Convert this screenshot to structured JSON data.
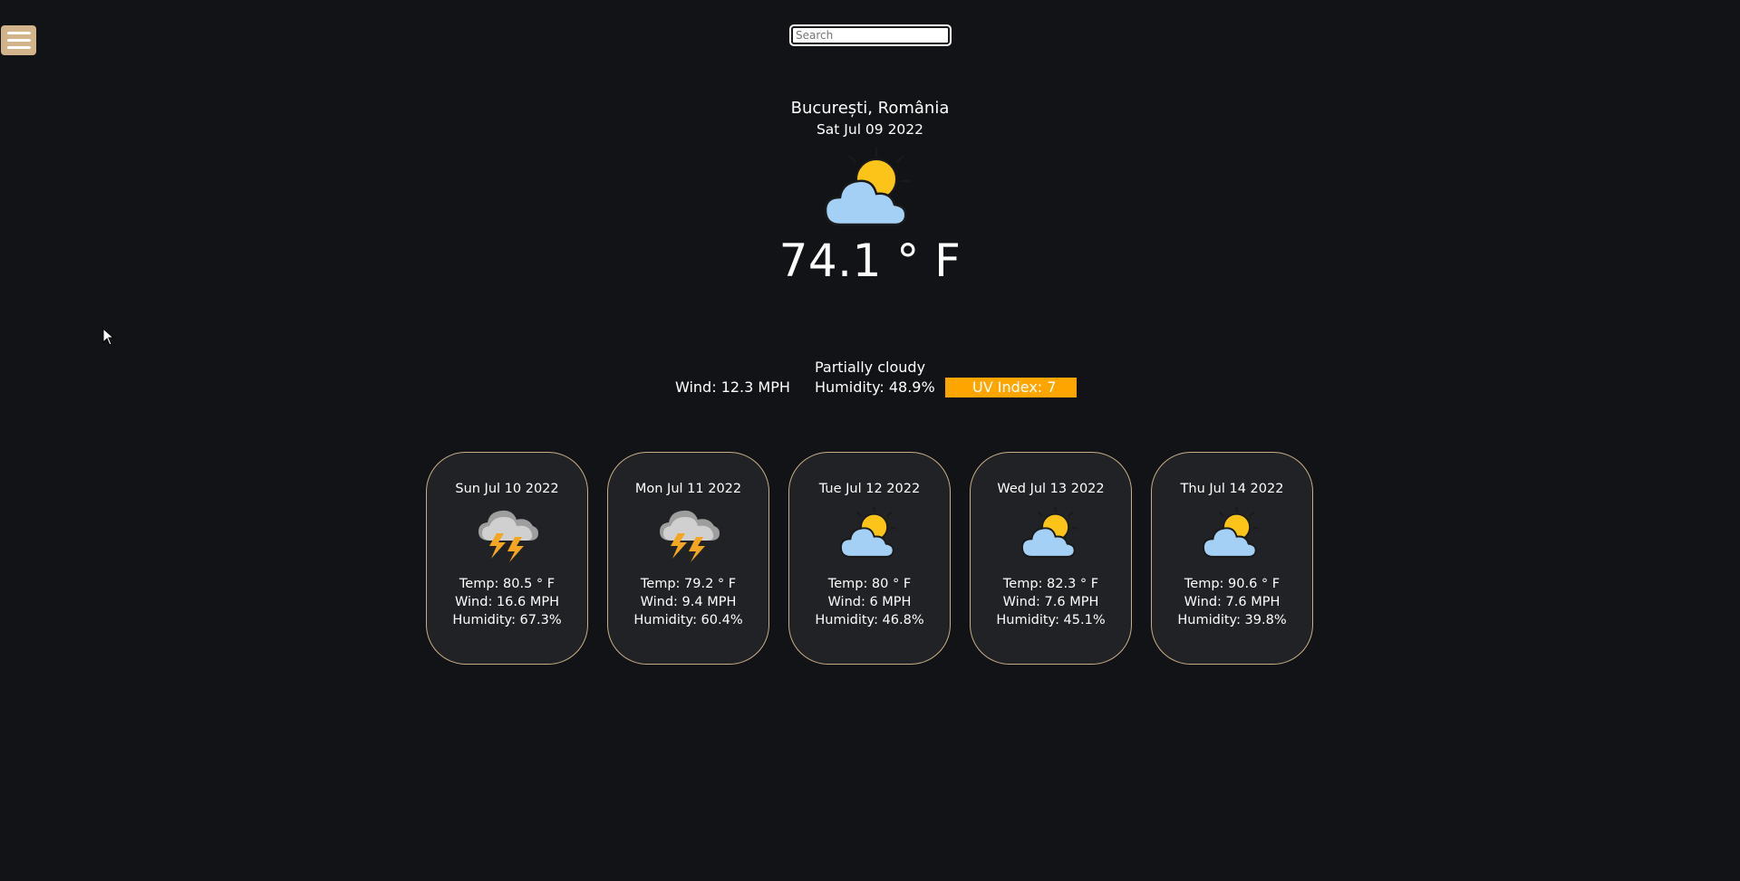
{
  "menu": {
    "icon": "hamburger-menu-icon"
  },
  "search": {
    "placeholder": "Search",
    "value": ""
  },
  "current": {
    "location": "București, România",
    "date": "Sat Jul 09 2022",
    "icon": "partly-cloudy-icon",
    "temperature": "74.1 ° F",
    "conditions": "Partially cloudy",
    "wind": "Wind: 12.3 MPH",
    "humidity": "Humidity: 48.9%",
    "uv": "UV Index: 7"
  },
  "colors": {
    "background": "#121317",
    "card_border": "#c9ad88",
    "uv_badge": "#ffa500",
    "menu_button": "#d2b48c"
  },
  "forecast": [
    {
      "date": "Sun Jul 10 2022",
      "icon": "thunderstorm-icon",
      "temp": "Temp: 80.5 ° F",
      "wind": "Wind: 16.6 MPH",
      "humidity": "Humidity: 67.3%"
    },
    {
      "date": "Mon Jul 11 2022",
      "icon": "thunderstorm-icon",
      "temp": "Temp: 79.2 ° F",
      "wind": "Wind: 9.4 MPH",
      "humidity": "Humidity: 60.4%"
    },
    {
      "date": "Tue Jul 12 2022",
      "icon": "partly-cloudy-icon",
      "temp": "Temp: 80 ° F",
      "wind": "Wind: 6 MPH",
      "humidity": "Humidity: 46.8%"
    },
    {
      "date": "Wed Jul 13 2022",
      "icon": "partly-cloudy-icon",
      "temp": "Temp: 82.3 ° F",
      "wind": "Wind: 7.6 MPH",
      "humidity": "Humidity: 45.1%"
    },
    {
      "date": "Thu Jul 14 2022",
      "icon": "partly-cloudy-icon",
      "temp": "Temp: 90.6 ° F",
      "wind": "Wind: 7.6 MPH",
      "humidity": "Humidity: 39.8%"
    }
  ]
}
